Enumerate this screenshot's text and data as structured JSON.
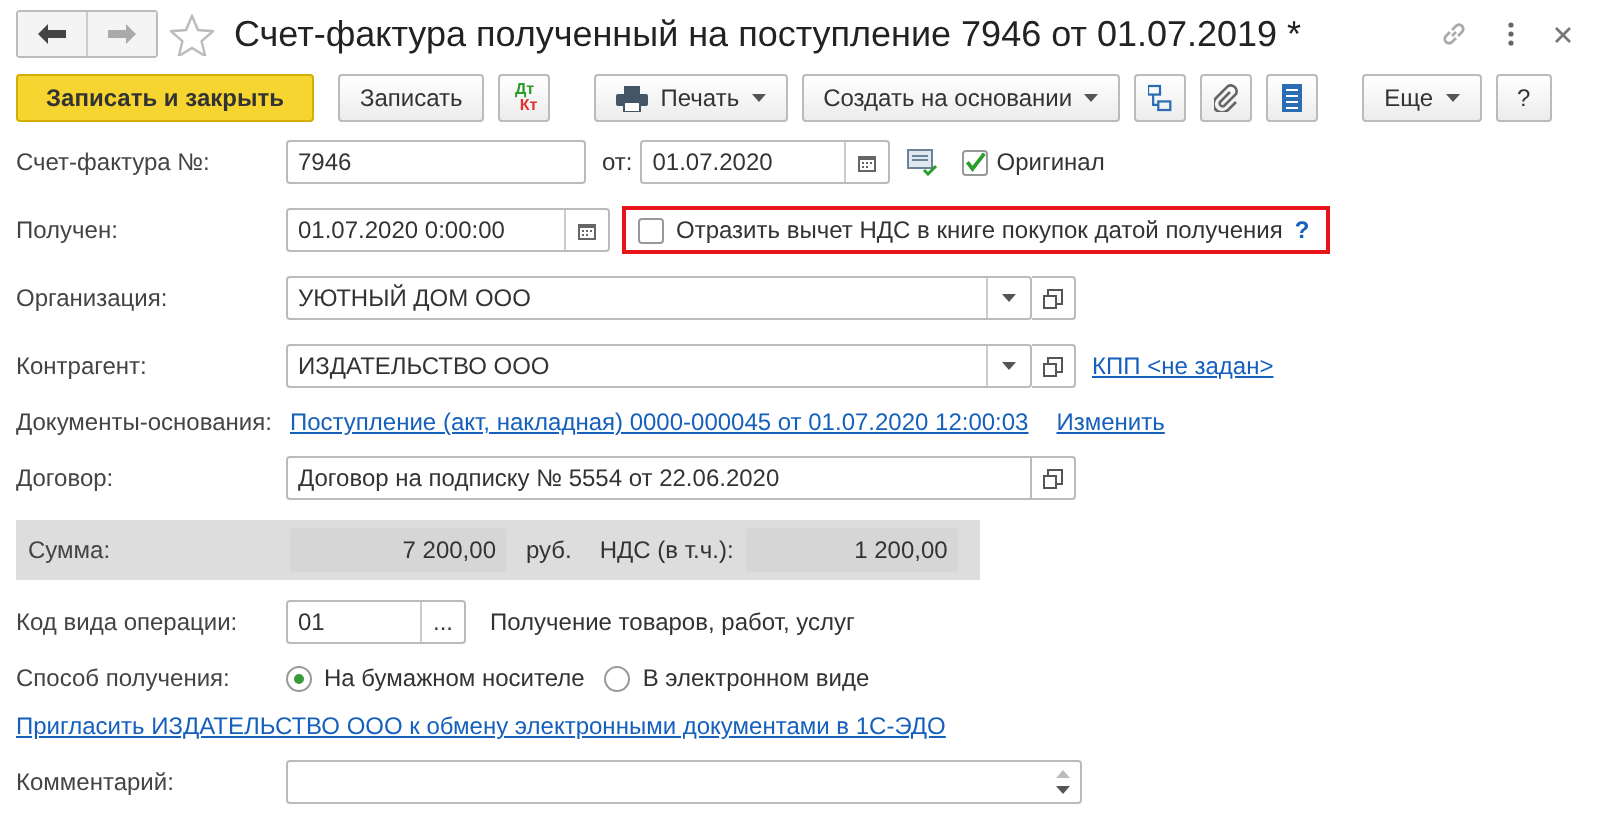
{
  "window": {
    "title": "Счет-фактура полученный на поступление 7946 от 01.07.2019 *",
    "favorite": false
  },
  "toolbar": [
    {
      "kind": "primary",
      "label": "Записать и закрыть"
    },
    {
      "kind": "button",
      "label": "Записать"
    },
    {
      "kind": "dtkt",
      "top": "Дт",
      "bottom": "Кт"
    },
    {
      "kind": "print",
      "label": "Печать"
    },
    {
      "kind": "menu",
      "label": "Создать на основании"
    },
    {
      "kind": "structure"
    },
    {
      "kind": "attach"
    },
    {
      "kind": "list"
    },
    {
      "kind": "menu",
      "label": "Еще"
    },
    {
      "kind": "button",
      "label": "?"
    }
  ],
  "invoice": {
    "label": "Счет-фактура №:",
    "number": "7946",
    "date_label": "от:",
    "date": "01.07.2020",
    "original": {
      "label": "Оригинал",
      "checked": true
    }
  },
  "received": {
    "label": "Получен:",
    "value": "01.07.2020  0:00:00",
    "deduction": {
      "label": "Отразить вычет НДС в книге покупок датой получения",
      "checked": false,
      "help": "?"
    }
  },
  "organization": {
    "label": "Организация:",
    "value": "УЮТНЫЙ ДОМ ООО"
  },
  "counterparty": {
    "label": "Контрагент:",
    "value": "ИЗДАТЕЛЬСТВО ООО",
    "kpp_link": "КПП <не задан>"
  },
  "base_documents": {
    "label": "Документы-основания:",
    "link": "Поступление (акт, накладная) 0000-000045 от 01.07.2020 12:00:03",
    "change_link": "Изменить"
  },
  "contract": {
    "label": "Договор:",
    "value": "Договор на подписку № 5554 от 22.06.2020"
  },
  "totals": {
    "sum_label": "Сумма:",
    "sum": "7 200,00",
    "currency": "руб.",
    "vat_label": "НДС (в т.ч.):",
    "vat": "1 200,00"
  },
  "operation_code": {
    "label": "Код вида операции:",
    "value": "01",
    "button": "...",
    "description": "Получение товаров, работ, услуг"
  },
  "receipt_method": {
    "label": "Способ получения:",
    "options": [
      {
        "label": "На бумажном носителе",
        "selected": true
      },
      {
        "label": "В электронном виде",
        "selected": false
      }
    ]
  },
  "invite_link": "Пригласить ИЗДАТЕЛЬСТВО ООО к обмену электронными документами в 1С-ЭДО",
  "comment": {
    "label": "Комментарий:"
  }
}
